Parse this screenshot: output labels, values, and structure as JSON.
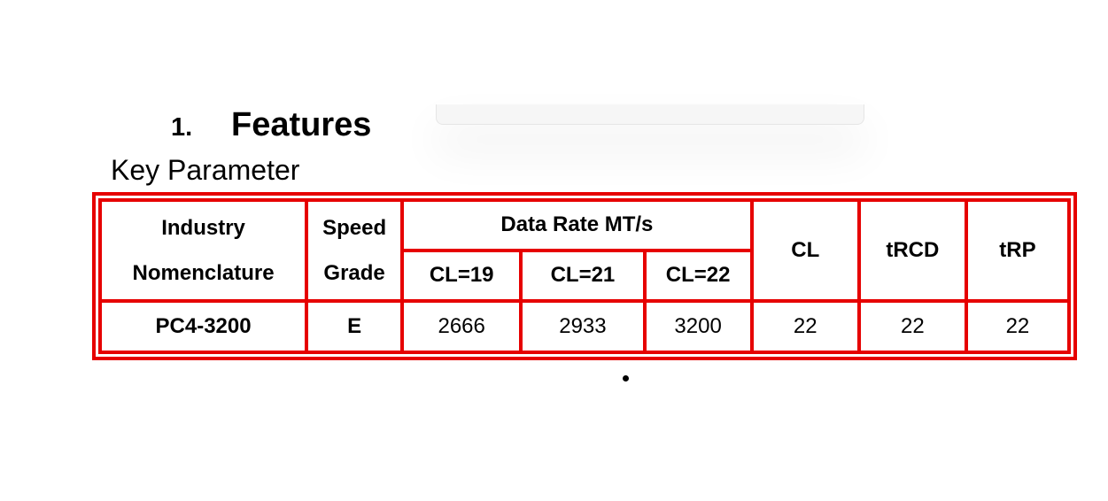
{
  "heading": {
    "number": "1.",
    "text": "Features"
  },
  "subheading": "Key Parameter",
  "table": {
    "headers": {
      "industry_line1": "Industry",
      "industry_line2": "Nomenclature",
      "speed_line1": "Speed",
      "speed_line2": "Grade",
      "data_rate": "Data Rate MT/s",
      "cl19": "CL=19",
      "cl21": "CL=21",
      "cl22": "CL=22",
      "cl": "CL",
      "trcd": "tRCD",
      "trp": "tRP"
    },
    "row": {
      "nomenclature": "PC4-3200",
      "speed_grade": "E",
      "rate_cl19": "2666",
      "rate_cl21": "2933",
      "rate_cl22": "3200",
      "cl": "22",
      "trcd": "22",
      "trp": "22"
    }
  },
  "colors": {
    "table_border": "#e60000"
  }
}
